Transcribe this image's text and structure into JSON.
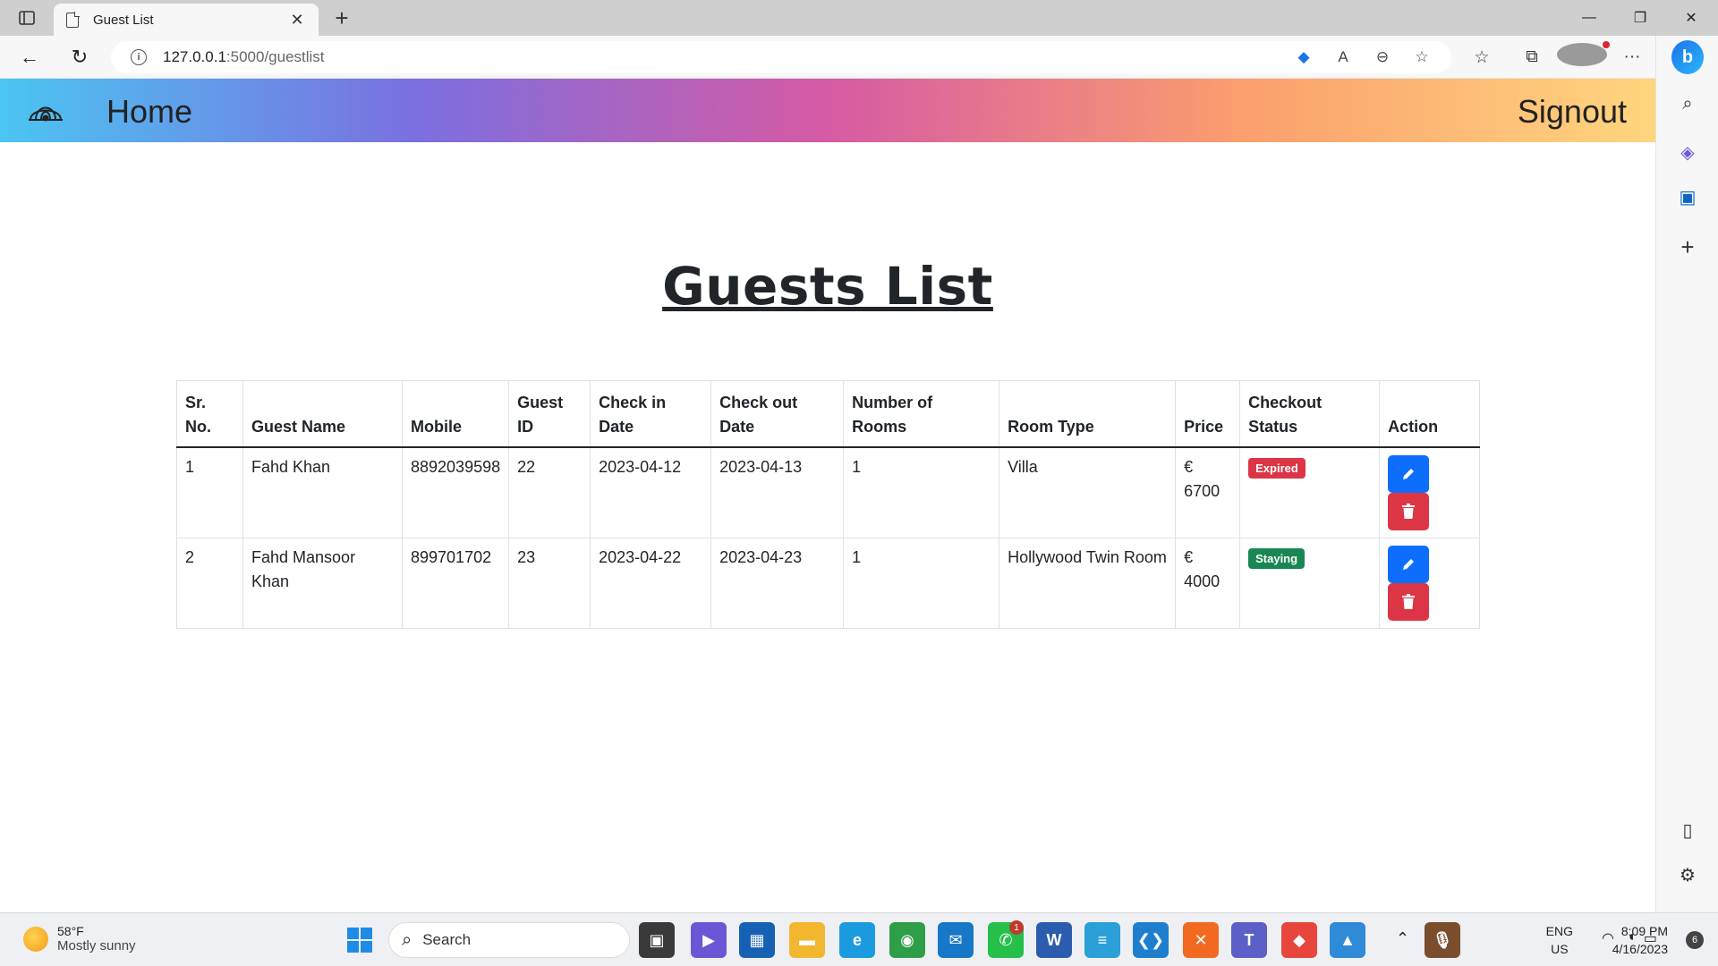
{
  "browser": {
    "tab_title": "Guest List",
    "url_host": "127.0.0.1",
    "url_path": ":5000/guestlist"
  },
  "navbar": {
    "home_label": "Home",
    "signout_label": "Signout",
    "colors": [
      "#4bc5f2",
      "#7b6fe0",
      "#d65aa4",
      "#fb9e6e",
      "#ffd67e"
    ]
  },
  "page": {
    "title": "Guests List"
  },
  "table": {
    "headers": [
      "Sr. No.",
      "Guest Name",
      "Mobile",
      "Guest ID",
      "Check in Date",
      "Check out Date",
      "Number of Rooms",
      "Room Type",
      "Price",
      "Checkout Status",
      "Action"
    ],
    "rows": [
      {
        "sr": "1",
        "name": "Fahd Khan",
        "mobile": "8892039598",
        "guest_id": "22",
        "check_in": "2023-04-12",
        "check_out": "2023-04-13",
        "rooms": "1",
        "room_type": "Villa",
        "price": "€ 6700",
        "status": "Expired"
      },
      {
        "sr": "2",
        "name": "Fahd Mansoor Khan",
        "mobile": "899701702",
        "guest_id": "23",
        "check_in": "2023-04-22",
        "check_out": "2023-04-23",
        "rooms": "1",
        "room_type": "Hollywood Twin Room",
        "price": "€ 4000",
        "status": "Staying"
      }
    ]
  },
  "taskbar": {
    "weather_temp": "58°F",
    "weather_desc": "Mostly sunny",
    "search_label": "Search",
    "lang_line1": "ENG",
    "lang_line2": "US",
    "time": "8:09 PM",
    "date": "4/16/2023",
    "notification_count": "6",
    "whatsapp_badge": "1"
  },
  "status_colors": {
    "expired": "#dc3545",
    "staying": "#198754",
    "edit": "#0d6efd",
    "delete": "#dc3545"
  }
}
